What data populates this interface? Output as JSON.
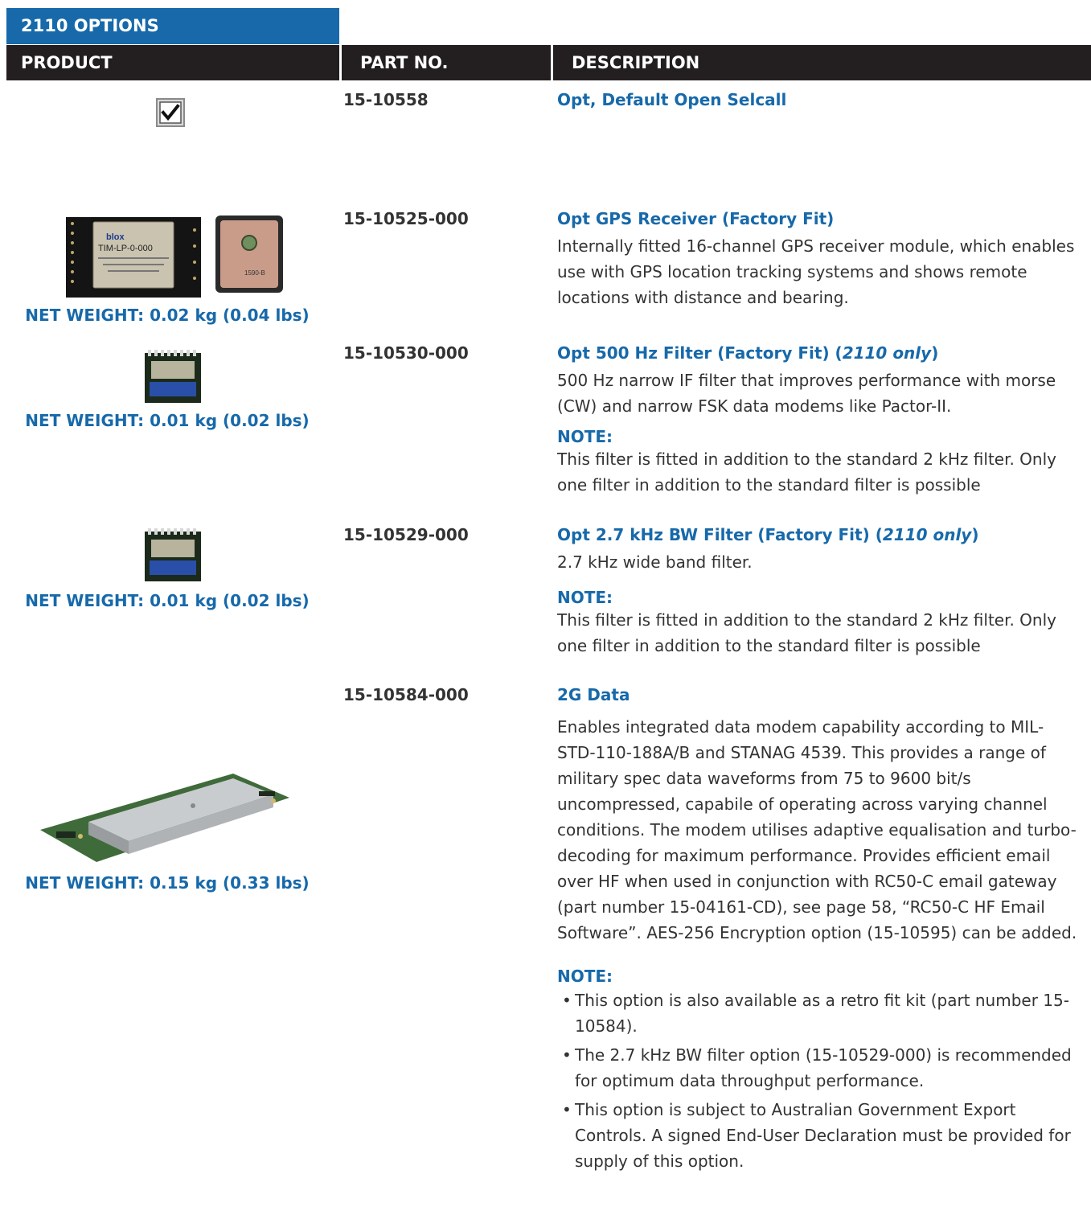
{
  "section_title": "2110 OPTIONS",
  "headers": {
    "product": "PRODUCT",
    "part_no": "PART NO.",
    "description": "DESCRIPTION"
  },
  "rows": [
    {
      "part_no": "15-10558",
      "title": "Opt, Default Open Selcall",
      "product_image": "checkbox-icon"
    },
    {
      "part_no": "15-10525-000",
      "title": "Opt GPS Receiver (Factory Fit)",
      "body": "Internally fitted 16-channel GPS receiver module, which enables use with GPS location tracking systems and shows remote locations with distance and bearing.",
      "weight": "NET WEIGHT: 0.02 kg (0.04 lbs)",
      "product_image": "gps-receiver-module-image",
      "module_label_1": "blox",
      "module_label_2": "TIM-LP-0-000",
      "antenna_label": "1590-B"
    },
    {
      "part_no": "15-10530-000",
      "title_main": "Opt 500 Hz Filter (Factory Fit) (",
      "title_italic": "2110 only",
      "title_end": ")",
      "body": "500 Hz narrow IF filter that improves performance with morse (CW) and narrow FSK data modems like Pactor-II.",
      "note_label": "NOTE:",
      "note": "This filter is fitted in addition to the standard 2 kHz filter. Only one filter in addition to the standard filter is possible",
      "weight": "NET WEIGHT: 0.01 kg (0.02 lbs)",
      "product_image": "filter-module-image"
    },
    {
      "part_no": "15-10529-000",
      "title_main": "Opt 2.7 kHz BW Filter (Factory Fit) (",
      "title_italic": "2110 only",
      "title_end": ")",
      "body": "2.7 kHz wide band filter.",
      "note_label": "NOTE:",
      "note": "This filter is fitted in addition to the standard 2 kHz filter. Only one filter in addition to the standard filter is possible",
      "weight": "NET WEIGHT: 0.01 kg (0.02 lbs)",
      "product_image": "filter-module-image"
    },
    {
      "part_no": "15-10584-000",
      "title": "2G Data",
      "body": "Enables integrated data modem capability according to MIL-STD-110-188A/B and STANAG 4539. This provides a range of military spec data waveforms from 75 to 9600 bit/s uncompressed, capabile of operating across varying channel conditions. The modem utilises adaptive equalisation and turbo-decoding for maximum performance. Provides efficient email over HF when used in conjunction with RC50-C email gateway (part number 15-04161-CD), see page 58, “RC50-C HF Email Software”. AES-256 Encryption option (15-10595) can be added.",
      "note_label": "NOTE:",
      "bullets": [
        "This option is also available as a retro fit kit (part number 15-10584).",
        "The 2.7 kHz BW filter option (15-10529-000) is recommended for optimum data throughput performance.",
        "This option is subject to Australian Government Export Controls. A signed End-User Declaration must be provided for supply of this option."
      ],
      "weight": "NET WEIGHT: 0.15 kg (0.33 lbs)",
      "product_image": "data-modem-board-image"
    }
  ],
  "colors": {
    "accent_blue": "#1769aa",
    "header_black": "#231f20",
    "text": "#333333"
  }
}
